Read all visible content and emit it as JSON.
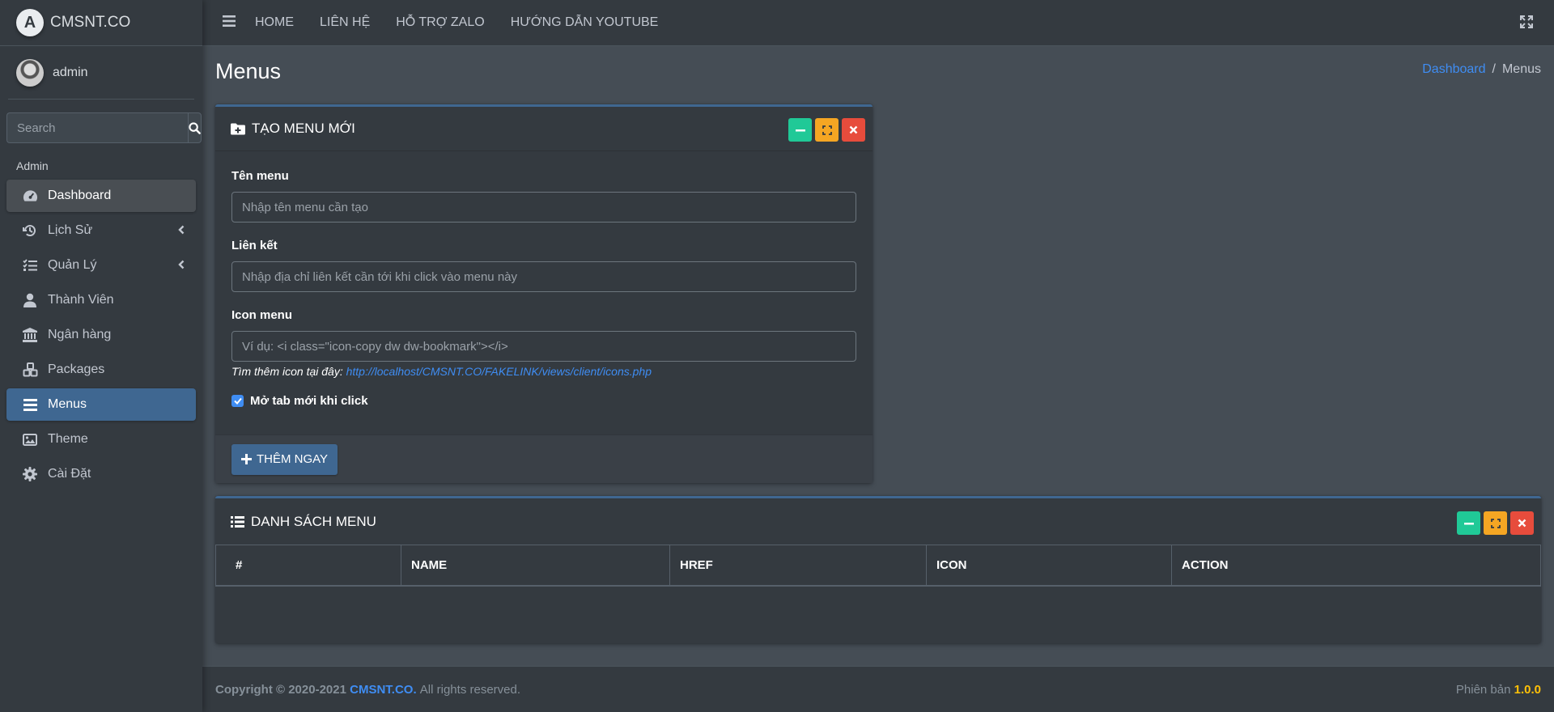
{
  "brand": {
    "name": "CMSNT.CO",
    "logo_letter": "A"
  },
  "user": {
    "name": "admin"
  },
  "search": {
    "placeholder": "Search"
  },
  "sidebar": {
    "header": "Admin",
    "items": [
      {
        "label": "Dashboard",
        "icon": "tachometer-icon"
      },
      {
        "label": "Lịch Sử",
        "icon": "history-icon"
      },
      {
        "label": "Quản Lý",
        "icon": "tasks-icon"
      },
      {
        "label": "Thành Viên",
        "icon": "user-icon"
      },
      {
        "label": "Ngân hàng",
        "icon": "bank-icon"
      },
      {
        "label": "Packages",
        "icon": "cubes-icon"
      },
      {
        "label": "Menus",
        "icon": "bars-icon"
      },
      {
        "label": "Theme",
        "icon": "image-icon"
      },
      {
        "label": "Cài Đặt",
        "icon": "gear-icon"
      }
    ]
  },
  "topnav": {
    "links": [
      "HOME",
      "LIÊN HỆ",
      "HỖ TRỢ ZALO",
      "HƯỚNG DẪN YOUTUBE"
    ]
  },
  "page": {
    "title": "Menus"
  },
  "breadcrumb": {
    "parent": "Dashboard",
    "sep": "/",
    "current": "Menus"
  },
  "create_card": {
    "title": "TẠO MENU MỚI",
    "name_label": "Tên menu",
    "name_placeholder": "Nhập tên menu cần tạo",
    "link_label": "Liên kết",
    "link_placeholder": "Nhập địa chỉ liên kết cần tới khi click vào menu này",
    "icon_label": "Icon menu",
    "icon_placeholder": "Ví dụ: <i class=\"icon-copy dw dw-bookmark\"></i>",
    "hint_text": "Tìm thêm icon tại đây:",
    "hint_link": "http://localhost/CMSNT.CO/FAKELINK/views/client/icons.php",
    "newtab_label": "Mở tab mới khi click",
    "submit_label": "THÊM NGAY"
  },
  "list_card": {
    "title": "DANH SÁCH MENU",
    "columns": [
      "#",
      "NAME",
      "HREF",
      "ICON",
      "ACTION"
    ]
  },
  "footer": {
    "copyright": "Copyright © 2020-2021",
    "brand": "CMSNT.CO.",
    "rights": "All rights reserved.",
    "version_label": "Phiên bản",
    "version": "1.0.0"
  },
  "colors": {
    "accent": "#3f6791",
    "link": "#3f8df3",
    "tool_green": "#20c997",
    "tool_yellow": "#f5a623",
    "tool_red": "#e74c3c",
    "version": "#ffc107"
  }
}
